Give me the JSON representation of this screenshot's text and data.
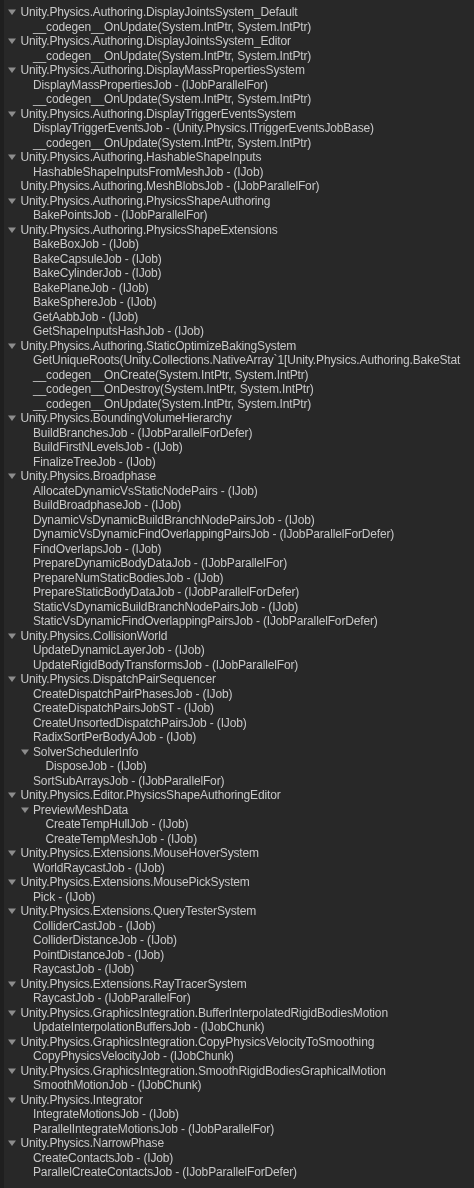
{
  "tree": [
    {
      "label": "Unity.Physics.Authoring.DisplayJointsSystem_Default",
      "expanded": true,
      "children": [
        {
          "label": "__codegen__OnUpdate(System.IntPtr, System.IntPtr)"
        }
      ]
    },
    {
      "label": "Unity.Physics.Authoring.DisplayJointsSystem_Editor",
      "expanded": true,
      "children": [
        {
          "label": "__codegen__OnUpdate(System.IntPtr, System.IntPtr)"
        }
      ]
    },
    {
      "label": "Unity.Physics.Authoring.DisplayMassPropertiesSystem",
      "expanded": true,
      "children": [
        {
          "label": "DisplayMassPropertiesJob - (IJobParallelFor)"
        },
        {
          "label": "__codegen__OnUpdate(System.IntPtr, System.IntPtr)"
        }
      ]
    },
    {
      "label": "Unity.Physics.Authoring.DisplayTriggerEventsSystem",
      "expanded": true,
      "children": [
        {
          "label": "DisplayTriggerEventsJob - (Unity.Physics.ITriggerEventsJobBase)"
        },
        {
          "label": "__codegen__OnUpdate(System.IntPtr, System.IntPtr)"
        }
      ]
    },
    {
      "label": "Unity.Physics.Authoring.HashableShapeInputs",
      "expanded": true,
      "children": [
        {
          "label": "HashableShapeInputsFromMeshJob - (IJob)"
        }
      ]
    },
    {
      "label": "Unity.Physics.Authoring.MeshBlobsJob - (IJobParallelFor)"
    },
    {
      "label": "Unity.Physics.Authoring.PhysicsShapeAuthoring",
      "expanded": true,
      "children": [
        {
          "label": "BakePointsJob - (IJobParallelFor)"
        }
      ]
    },
    {
      "label": "Unity.Physics.Authoring.PhysicsShapeExtensions",
      "expanded": true,
      "children": [
        {
          "label": "BakeBoxJob - (IJob)"
        },
        {
          "label": "BakeCapsuleJob - (IJob)"
        },
        {
          "label": "BakeCylinderJob - (IJob)"
        },
        {
          "label": "BakePlaneJob - (IJob)"
        },
        {
          "label": "BakeSphereJob - (IJob)"
        },
        {
          "label": "GetAabbJob - (IJob)"
        },
        {
          "label": "GetShapeInputsHashJob - (IJob)"
        }
      ]
    },
    {
      "label": "Unity.Physics.Authoring.StaticOptimizeBakingSystem",
      "expanded": true,
      "children": [
        {
          "label": "GetUniqueRoots(Unity.Collections.NativeArray`1[Unity.Physics.Authoring.BakeStat"
        },
        {
          "label": "__codegen__OnCreate(System.IntPtr, System.IntPtr)"
        },
        {
          "label": "__codegen__OnDestroy(System.IntPtr, System.IntPtr)"
        },
        {
          "label": "__codegen__OnUpdate(System.IntPtr, System.IntPtr)"
        }
      ]
    },
    {
      "label": "Unity.Physics.BoundingVolumeHierarchy",
      "expanded": true,
      "children": [
        {
          "label": "BuildBranchesJob - (IJobParallelForDefer)"
        },
        {
          "label": "BuildFirstNLevelsJob - (IJob)"
        },
        {
          "label": "FinalizeTreeJob - (IJob)"
        }
      ]
    },
    {
      "label": "Unity.Physics.Broadphase",
      "expanded": true,
      "children": [
        {
          "label": "AllocateDynamicVsStaticNodePairs - (IJob)"
        },
        {
          "label": "BuildBroadphaseJob - (IJob)"
        },
        {
          "label": "DynamicVsDynamicBuildBranchNodePairsJob - (IJob)"
        },
        {
          "label": "DynamicVsDynamicFindOverlappingPairsJob - (IJobParallelForDefer)"
        },
        {
          "label": "FindOverlapsJob - (IJob)"
        },
        {
          "label": "PrepareDynamicBodyDataJob - (IJobParallelFor)"
        },
        {
          "label": "PrepareNumStaticBodiesJob - (IJob)"
        },
        {
          "label": "PrepareStaticBodyDataJob - (IJobParallelForDefer)"
        },
        {
          "label": "StaticVsDynamicBuildBranchNodePairsJob - (IJob)"
        },
        {
          "label": "StaticVsDynamicFindOverlappingPairsJob - (IJobParallelForDefer)"
        }
      ]
    },
    {
      "label": "Unity.Physics.CollisionWorld",
      "expanded": true,
      "children": [
        {
          "label": "UpdateDynamicLayerJob - (IJob)"
        },
        {
          "label": "UpdateRigidBodyTransformsJob - (IJobParallelFor)"
        }
      ]
    },
    {
      "label": "Unity.Physics.DispatchPairSequencer",
      "expanded": true,
      "children": [
        {
          "label": "CreateDispatchPairPhasesJob - (IJob)"
        },
        {
          "label": "CreateDispatchPairsJobST - (IJob)"
        },
        {
          "label": "CreateUnsortedDispatchPairsJob - (IJob)"
        },
        {
          "label": "RadixSortPerBodyAJob - (IJob)"
        },
        {
          "label": "SolverSchedulerInfo",
          "expanded": true,
          "children": [
            {
              "label": "DisposeJob - (IJob)"
            }
          ]
        },
        {
          "label": "SortSubArraysJob - (IJobParallelFor)"
        }
      ]
    },
    {
      "label": "Unity.Physics.Editor.PhysicsShapeAuthoringEditor",
      "expanded": true,
      "children": [
        {
          "label": "PreviewMeshData",
          "expanded": true,
          "children": [
            {
              "label": "CreateTempHullJob - (IJob)"
            },
            {
              "label": "CreateTempMeshJob - (IJob)"
            }
          ]
        }
      ]
    },
    {
      "label": "Unity.Physics.Extensions.MouseHoverSystem",
      "expanded": true,
      "children": [
        {
          "label": "WorldRaycastJob - (IJob)"
        }
      ]
    },
    {
      "label": "Unity.Physics.Extensions.MousePickSystem",
      "expanded": true,
      "children": [
        {
          "label": "Pick - (IJob)"
        }
      ]
    },
    {
      "label": "Unity.Physics.Extensions.QueryTesterSystem",
      "expanded": true,
      "children": [
        {
          "label": "ColliderCastJob - (IJob)"
        },
        {
          "label": "ColliderDistanceJob - (IJob)"
        },
        {
          "label": "PointDistanceJob - (IJob)"
        },
        {
          "label": "RaycastJob - (IJob)"
        }
      ]
    },
    {
      "label": "Unity.Physics.Extensions.RayTracerSystem",
      "expanded": true,
      "children": [
        {
          "label": "RaycastJob - (IJobParallelFor)"
        }
      ]
    },
    {
      "label": "Unity.Physics.GraphicsIntegration.BufferInterpolatedRigidBodiesMotion",
      "expanded": true,
      "children": [
        {
          "label": "UpdateInterpolationBuffersJob - (IJobChunk)"
        }
      ]
    },
    {
      "label": "Unity.Physics.GraphicsIntegration.CopyPhysicsVelocityToSmoothing",
      "expanded": true,
      "children": [
        {
          "label": "CopyPhysicsVelocityJob - (IJobChunk)"
        }
      ]
    },
    {
      "label": "Unity.Physics.GraphicsIntegration.SmoothRigidBodiesGraphicalMotion",
      "expanded": true,
      "children": [
        {
          "label": "SmoothMotionJob - (IJobChunk)"
        }
      ]
    },
    {
      "label": "Unity.Physics.Integrator",
      "expanded": true,
      "children": [
        {
          "label": "IntegrateMotionsJob - (IJob)"
        },
        {
          "label": "ParallelIntegrateMotionsJob - (IJobParallelFor)"
        }
      ]
    },
    {
      "label": "Unity.Physics.NarrowPhase",
      "expanded": true,
      "children": [
        {
          "label": "CreateContactsJob - (IJob)"
        },
        {
          "label": "ParallelCreateContactsJob - (IJobParallelForDefer)"
        }
      ]
    }
  ]
}
